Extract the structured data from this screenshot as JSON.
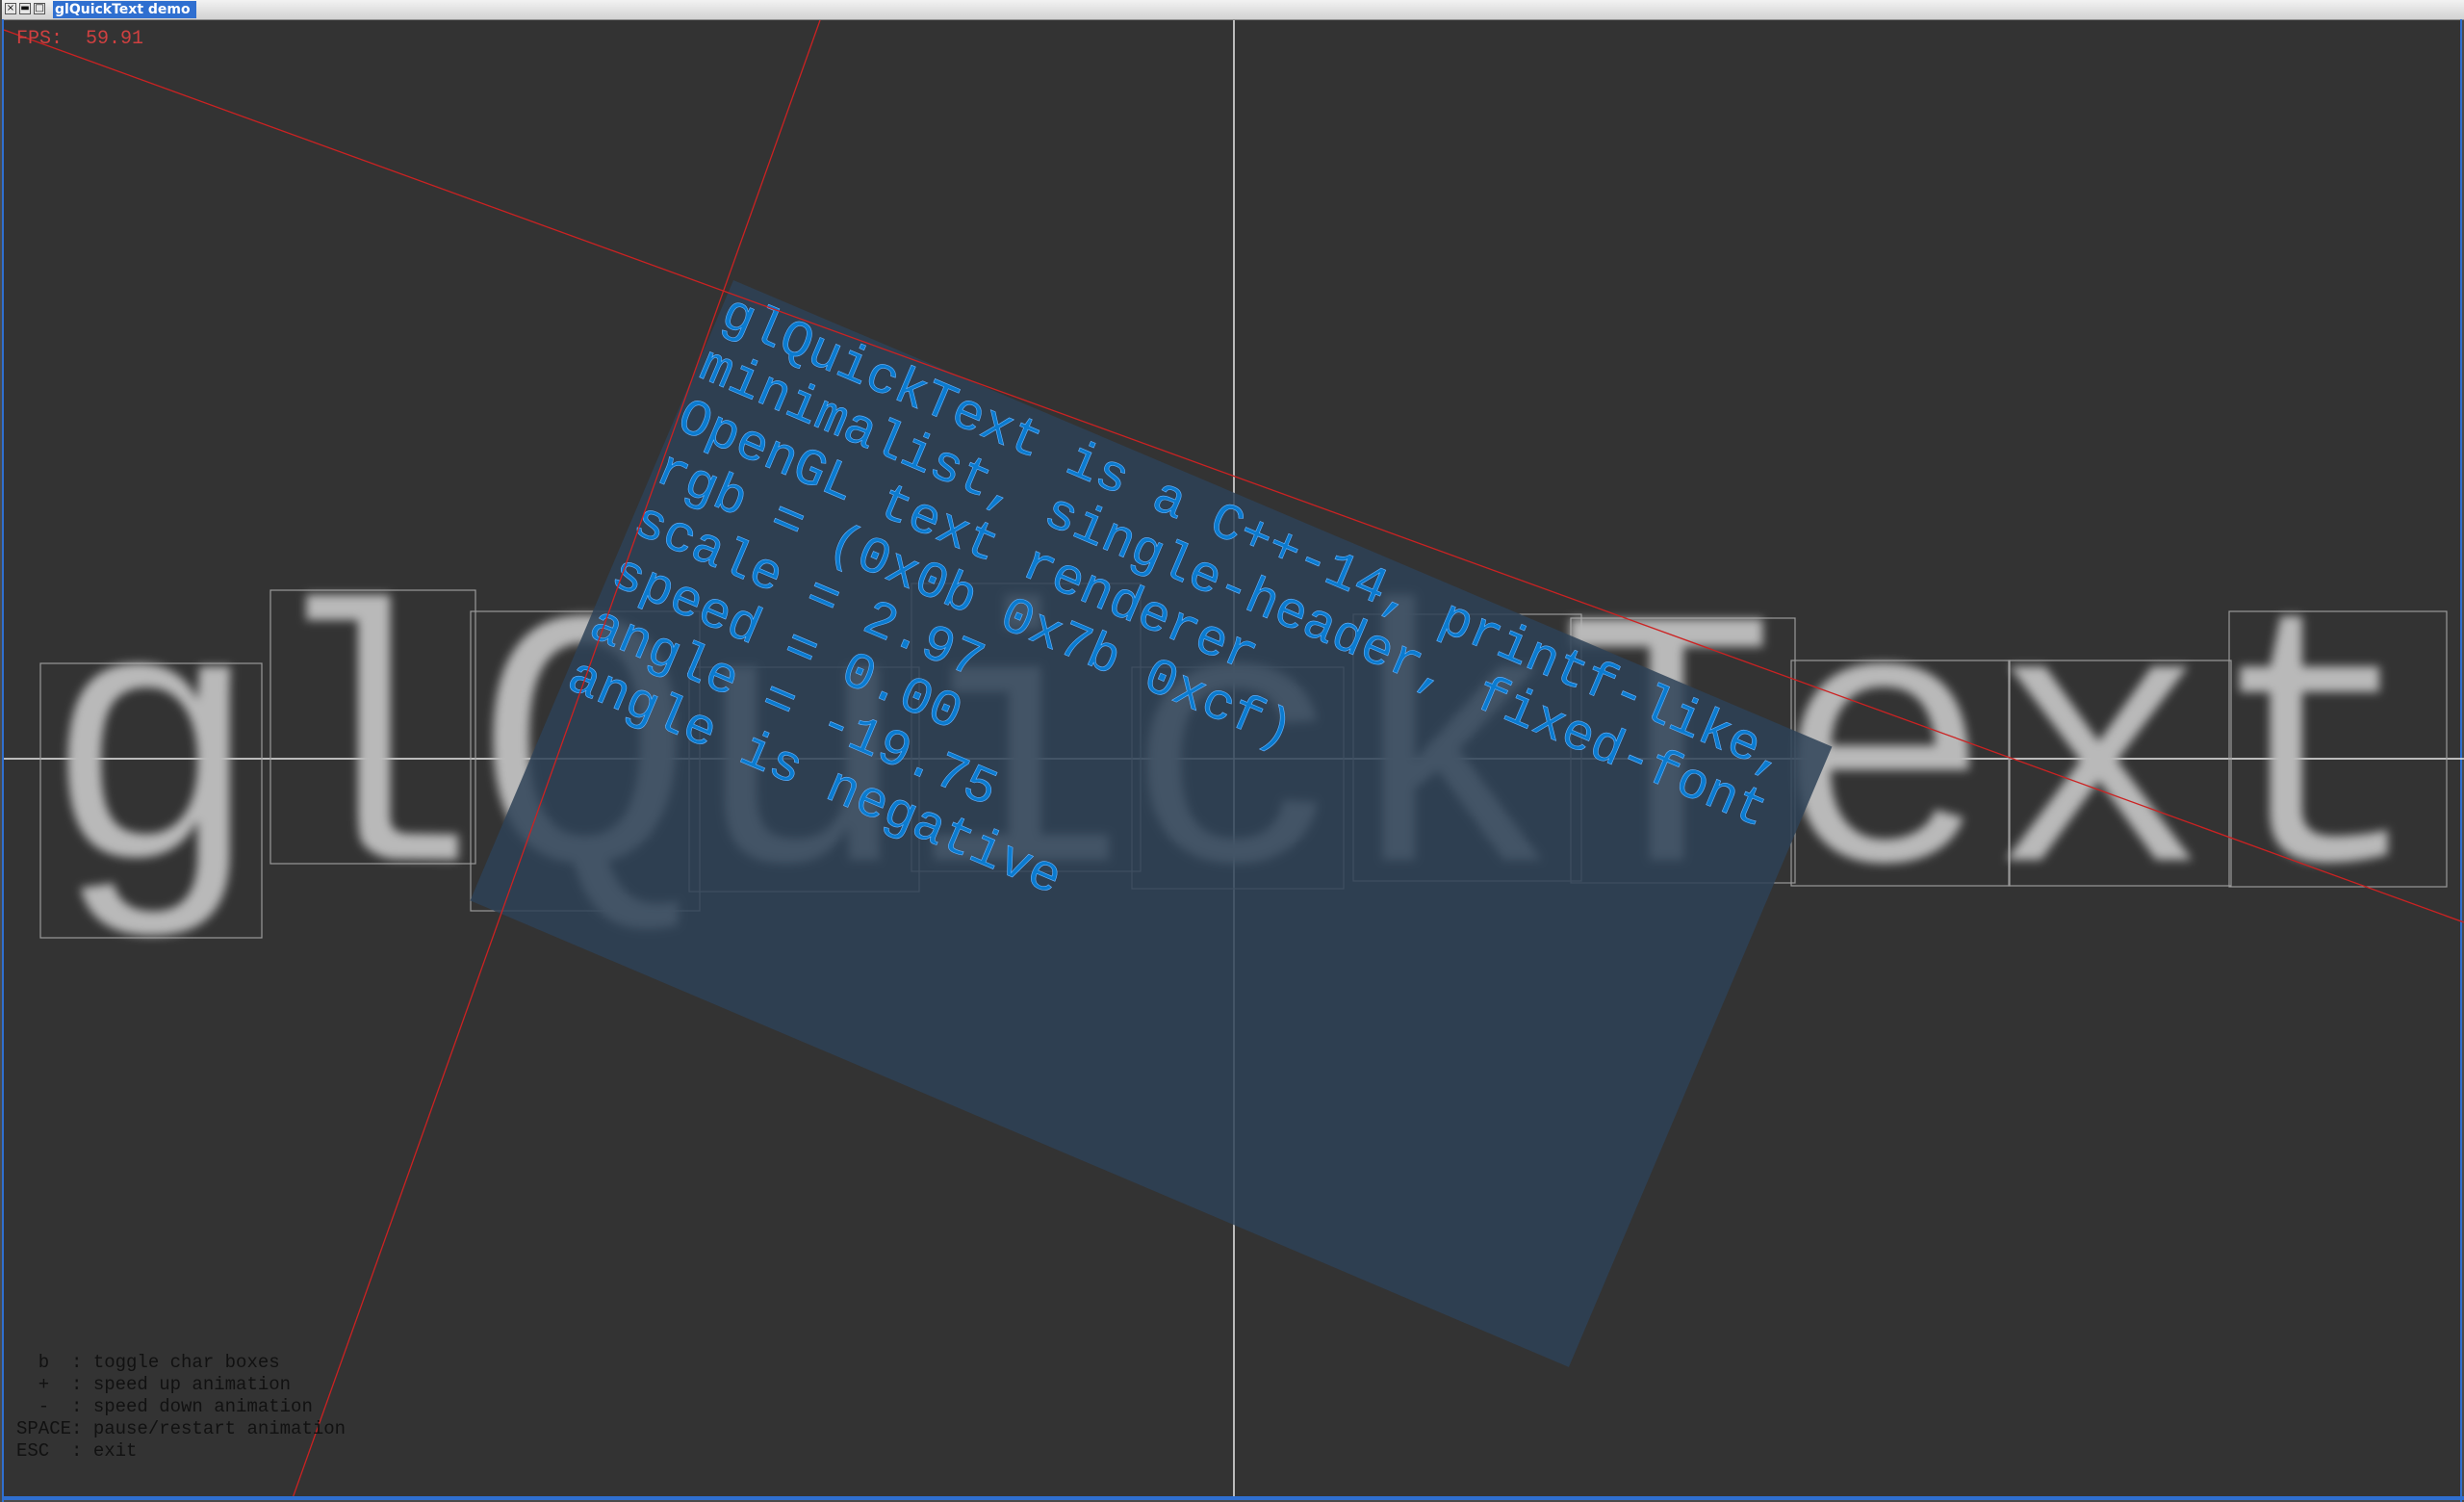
{
  "window": {
    "title": "glQuickText demo",
    "close_glyph": "×",
    "minimize_glyph": "▬",
    "maximize_glyph": "□"
  },
  "hud": {
    "fps_label": "FPS:",
    "fps_value": "59.91"
  },
  "big_text": {
    "text": "glQuickText",
    "color": "#b9b9b9"
  },
  "rotated_block": {
    "lines": [
      "glQuickText is a C++-14, printf-like,",
      "minimalist, single-header, fixed-font",
      "OpenGL text renderer",
      "rgb = (0x0b 0x7b 0xcf)",
      "scale = 2.97",
      "speed = 0.00",
      "angle = -19.75",
      "angle is negative"
    ],
    "text_color": "#0b7bcf",
    "angle": -19.75
  },
  "help": {
    "lines": [
      "  b  : toggle char boxes",
      "  +  : speed up animation",
      "  -  : speed down animation",
      "SPACE: pause/restart animation",
      "ESC  : exit"
    ]
  },
  "colors": {
    "background": "#333333",
    "axis_red": "#cc2222",
    "crosshair": "#e8e8e8",
    "box_stroke": "#9a9a9a",
    "panel_fill": "#2e4257"
  }
}
